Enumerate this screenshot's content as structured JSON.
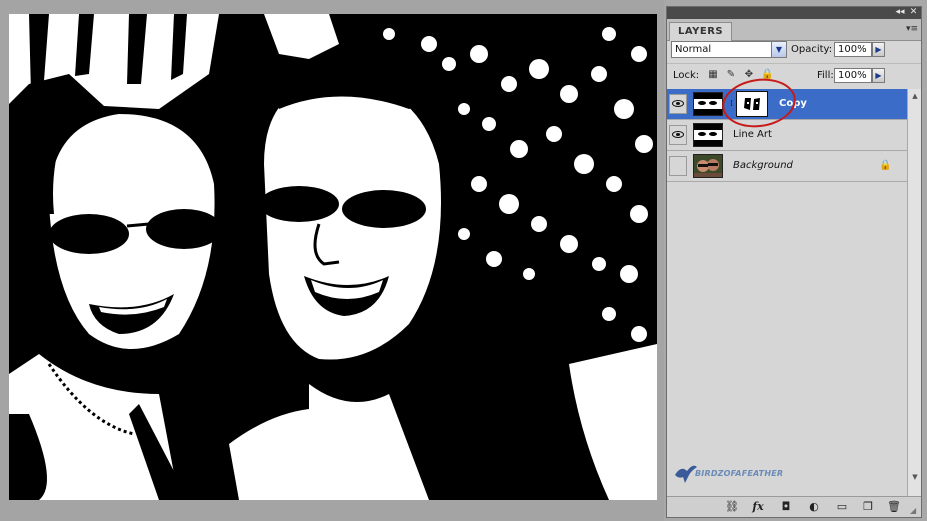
{
  "panel": {
    "tab_label": "LAYERS",
    "collapse_glyph": "◂◂",
    "close_glyph": "✕",
    "menu_glyph": "▾≡",
    "blend_mode": "Normal",
    "opacity_label": "Opacity:",
    "opacity_value": "100%",
    "lock_label": "Lock:",
    "fill_label": "Fill:",
    "fill_value": "100%",
    "lock_icons": [
      "transparency-lock-icon",
      "brush-lock-icon",
      "move-lock-icon",
      "padlock-icon"
    ]
  },
  "layers": [
    {
      "name": "Copy",
      "visible": true,
      "selected": true,
      "has_mask": true
    },
    {
      "name": "Line Art",
      "visible": true,
      "selected": false,
      "has_mask": false
    },
    {
      "name": "Background",
      "visible": false,
      "selected": false,
      "locked": true
    }
  ],
  "watermark": {
    "text": "BIRDZOFAFEATHER"
  },
  "bottom_tools": [
    {
      "name": "link-layers-icon",
      "glyph": "⛓"
    },
    {
      "name": "fx-icon",
      "glyph": "fx"
    },
    {
      "name": "add-mask-icon",
      "glyph": "◘"
    },
    {
      "name": "adjustment-icon",
      "glyph": "◐"
    },
    {
      "name": "new-group-icon",
      "glyph": "▭"
    },
    {
      "name": "new-layer-icon",
      "glyph": "❐"
    },
    {
      "name": "trash-icon",
      "glyph": "🗑"
    }
  ],
  "colors": {
    "selection": "#3a6cc8",
    "annotation": "#c81a1a",
    "panel_bg": "#d6d6d6"
  }
}
